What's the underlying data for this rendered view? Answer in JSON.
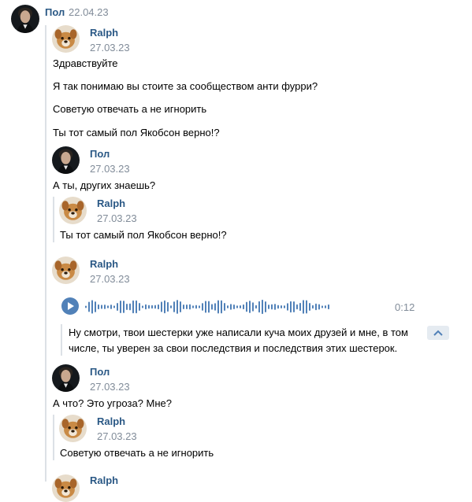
{
  "post": {
    "author": "Пол",
    "date": "22.04.23"
  },
  "forwarded": [
    {
      "author": "Ralph",
      "date": "27.03.23",
      "lines": [
        "Здравствуйте",
        "Я так понимаю вы стоите за сообществом анти фурри?",
        "Советую отвечать а не игнорить",
        "Ты тот самый пол Якобсон верно!?"
      ]
    },
    {
      "author": "Пол",
      "date": "27.03.23",
      "text": "А ты, других знаешь?",
      "quote": {
        "author": "Ralph",
        "date": "27.03.23",
        "text": "Ты тот самый пол Якобсон верно!?"
      }
    },
    {
      "author": "Ralph",
      "date": "27.03.23",
      "voice": {
        "duration": "0:12",
        "transcript": "Ну смотри, твои шестерки уже написали куча моих друзей и мне, в том числе, ты уверен за свои последствия и последствия этих шестерок."
      }
    },
    {
      "author": "Пол",
      "date": "27.03.23",
      "text": "А что? Это угроза? Мне?",
      "quote": {
        "author": "Ralph",
        "date": "27.03.23",
        "text": "Советую отвечать а не игнорить"
      }
    },
    {
      "author": "Ralph"
    }
  ],
  "colors": {
    "link": "#2a5885",
    "meta": "#818c99",
    "accent": "#5181b8",
    "divider": "#dce1e6"
  }
}
